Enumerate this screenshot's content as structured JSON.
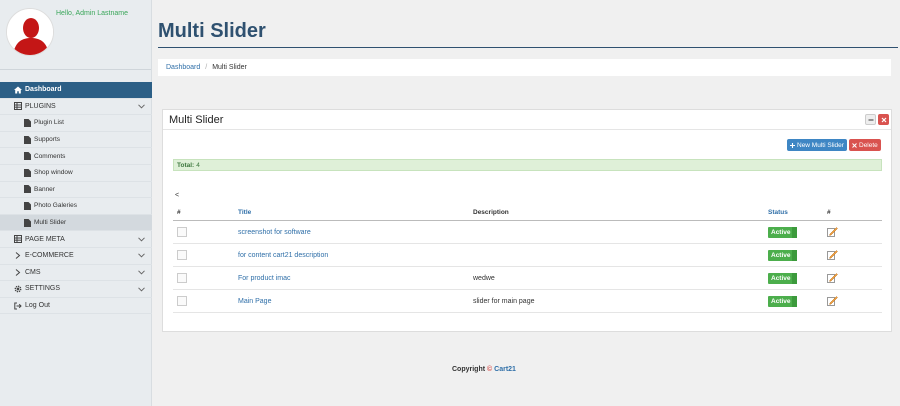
{
  "sidebar": {
    "greeting": "Hello, Admin Lastname",
    "menu": {
      "dashboard": "Dashboard",
      "plugins": "PLUGINS",
      "plugin_list": "Plugin List",
      "supports": "Supports",
      "comments": "Comments",
      "shop_window": "Shop window",
      "banner": "Banner",
      "photo_galeries": "Photo Galeries",
      "multi_slider": "Multi Slider",
      "page_meta": "PAGE META",
      "ecommerce": "E-COMMERCE",
      "cms": "CMS",
      "settings": "SETTINGS",
      "log_out": "Log Out"
    }
  },
  "header": {
    "title": "Multi Slider",
    "breadcrumb": {
      "home": "Dashboard",
      "sep": "/",
      "current": "Multi Slider"
    }
  },
  "panel": {
    "title": "Multi Slider",
    "new_button": "New Multi Slider",
    "delete_button": "Delete",
    "total_label": "Total:",
    "total_value": "4",
    "lt": "<",
    "columns": {
      "hash": "#",
      "title": "Title",
      "description": "Description",
      "status": "Status",
      "edit": "#"
    },
    "rows": [
      {
        "title": "screenshot for software",
        "description": "",
        "status": "Active"
      },
      {
        "title": "for content cart21 description",
        "description": "",
        "status": "Active"
      },
      {
        "title": "For product imac",
        "description": "wedwe",
        "status": "Active"
      },
      {
        "title": "Main Page",
        "description": "slider for main page",
        "status": "Active"
      }
    ]
  },
  "footer": {
    "copyright": "Copyright",
    "symbol": "©",
    "brand": "Cart21"
  },
  "colors": {
    "primary": "#2c5f86",
    "accent": "#3e86c4",
    "danger": "#d9534f",
    "success": "#4cae4c"
  }
}
